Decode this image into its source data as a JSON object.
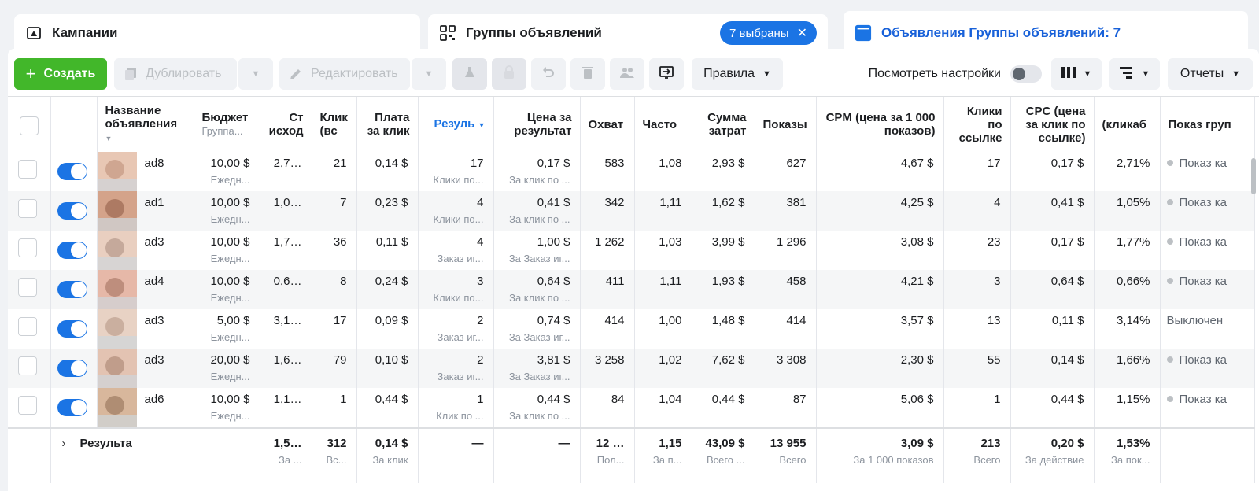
{
  "tabs": {
    "campaigns": "Кампании",
    "adsets": "Группы объявлений",
    "adsets_chip": "7 выбраны",
    "ads": "Объявления Группы объявлений: 7"
  },
  "toolbar": {
    "create": "Создать",
    "duplicate": "Дублировать",
    "edit": "Редактировать",
    "rules": "Правила",
    "view_settings": "Посмотреть настройки",
    "reports": "Отчеты"
  },
  "columns": {
    "name": "Название объявления",
    "budget": "Бюджет",
    "budget_sub": "Группа...",
    "cost_src": "Ст исход",
    "clicks_all": "Клик (вс",
    "cpc_all": "Плата за клик",
    "results": "Резуль",
    "cost_per_result": "Цена за результат",
    "reach": "Охват",
    "frequency": "Часто",
    "spend": "Сумма затрат",
    "impressions": "Показы",
    "cpm": "CPM (цена за 1 000 показов)",
    "link_clicks": "Клики по ссылке",
    "cpc_link": "CPC (цена за клик по ссылке)",
    "ctr": "(кликаб",
    "delivery": "Показ груп"
  },
  "rows": [
    {
      "name": "ad8",
      "budget": "10,00 $",
      "budget_sub": "Ежедн...",
      "cost_src": "2,7…",
      "clicks_all": "21",
      "cpc_all": "0,14 $",
      "results": "17",
      "results_sub": "Клики по...",
      "cpr": "0,17 $",
      "cpr_sub": "За клик по ...",
      "reach": "583",
      "freq": "1,08",
      "spend": "2,93 $",
      "impr": "627",
      "cpm": "4,67 $",
      "link_clicks": "17",
      "cpc_link": "0,17 $",
      "ctr": "2,71%",
      "delivery": "Показ ка",
      "delivery_on": true
    },
    {
      "name": "ad1",
      "budget": "10,00 $",
      "budget_sub": "Ежедн...",
      "cost_src": "1,0…",
      "clicks_all": "7",
      "cpc_all": "0,23 $",
      "results": "4",
      "results_sub": "Клики по...",
      "cpr": "0,41 $",
      "cpr_sub": "За клик по ...",
      "reach": "342",
      "freq": "1,11",
      "spend": "1,62 $",
      "impr": "381",
      "cpm": "4,25 $",
      "link_clicks": "4",
      "cpc_link": "0,41 $",
      "ctr": "1,05%",
      "delivery": "Показ ка",
      "delivery_on": true
    },
    {
      "name": "ad3",
      "budget": "10,00 $",
      "budget_sub": "Ежедн...",
      "cost_src": "1,7…",
      "clicks_all": "36",
      "cpc_all": "0,11 $",
      "results": "4",
      "results_sub": "Заказ иг...",
      "cpr": "1,00 $",
      "cpr_sub": "За Заказ иг...",
      "reach": "1 262",
      "freq": "1,03",
      "spend": "3,99 $",
      "impr": "1 296",
      "cpm": "3,08 $",
      "link_clicks": "23",
      "cpc_link": "0,17 $",
      "ctr": "1,77%",
      "delivery": "Показ ка",
      "delivery_on": true
    },
    {
      "name": "ad4",
      "budget": "10,00 $",
      "budget_sub": "Ежедн...",
      "cost_src": "0,6…",
      "clicks_all": "8",
      "cpc_all": "0,24 $",
      "results": "3",
      "results_sub": "Клики по...",
      "cpr": "0,64 $",
      "cpr_sub": "За клик по ...",
      "reach": "411",
      "freq": "1,11",
      "spend": "1,93 $",
      "impr": "458",
      "cpm": "4,21 $",
      "link_clicks": "3",
      "cpc_link": "0,64 $",
      "ctr": "0,66%",
      "delivery": "Показ ка",
      "delivery_on": true
    },
    {
      "name": "ad3",
      "budget": "5,00 $",
      "budget_sub": "Ежедн...",
      "cost_src": "3,1…",
      "clicks_all": "17",
      "cpc_all": "0,09 $",
      "results": "2",
      "results_sub": "Заказ иг...",
      "cpr": "0,74 $",
      "cpr_sub": "За Заказ иг...",
      "reach": "414",
      "freq": "1,00",
      "spend": "1,48 $",
      "impr": "414",
      "cpm": "3,57 $",
      "link_clicks": "13",
      "cpc_link": "0,11 $",
      "ctr": "3,14%",
      "delivery": "Выключен",
      "delivery_on": false
    },
    {
      "name": "ad3",
      "budget": "20,00 $",
      "budget_sub": "Ежедн...",
      "cost_src": "1,6…",
      "clicks_all": "79",
      "cpc_all": "0,10 $",
      "results": "2",
      "results_sub": "Заказ иг...",
      "cpr": "3,81 $",
      "cpr_sub": "За Заказ иг...",
      "reach": "3 258",
      "freq": "1,02",
      "spend": "7,62 $",
      "impr": "3 308",
      "cpm": "2,30 $",
      "link_clicks": "55",
      "cpc_link": "0,14 $",
      "ctr": "1,66%",
      "delivery": "Показ ка",
      "delivery_on": true
    },
    {
      "name": "ad6",
      "budget": "10,00 $",
      "budget_sub": "Ежедн...",
      "cost_src": "1,1…",
      "clicks_all": "1",
      "cpc_all": "0,44 $",
      "results": "1",
      "results_sub": "Клик по ...",
      "cpr": "0,44 $",
      "cpr_sub": "За клик по ...",
      "reach": "84",
      "freq": "1,04",
      "spend": "0,44 $",
      "impr": "87",
      "cpm": "5,06 $",
      "link_clicks": "1",
      "cpc_link": "0,44 $",
      "ctr": "1,15%",
      "delivery": "Показ ка",
      "delivery_on": true
    }
  ],
  "totals": {
    "label": "Результа",
    "cost_src": "1,5…",
    "cost_src_sub": "За ...",
    "clicks_all": "312",
    "clicks_all_sub": "Вс...",
    "cpc_all": "0,14 $",
    "cpc_all_sub": "За клик",
    "results": "—",
    "cpr": "—",
    "reach": "12 …",
    "reach_sub": "Пол...",
    "freq": "1,15",
    "freq_sub": "За п...",
    "spend": "43,09 $",
    "spend_sub": "Всего ...",
    "impr": "13 955",
    "impr_sub": "Всего",
    "cpm": "3,09 $",
    "cpm_sub": "За 1 000 показов",
    "link_clicks": "213",
    "link_clicks_sub": "Всего",
    "cpc_link": "0,20 $",
    "cpc_link_sub": "За действие",
    "ctr": "1,53%",
    "ctr_sub": "За пок..."
  },
  "colors": {
    "accent": "#1b74e4",
    "create_green": "#42b72a"
  }
}
